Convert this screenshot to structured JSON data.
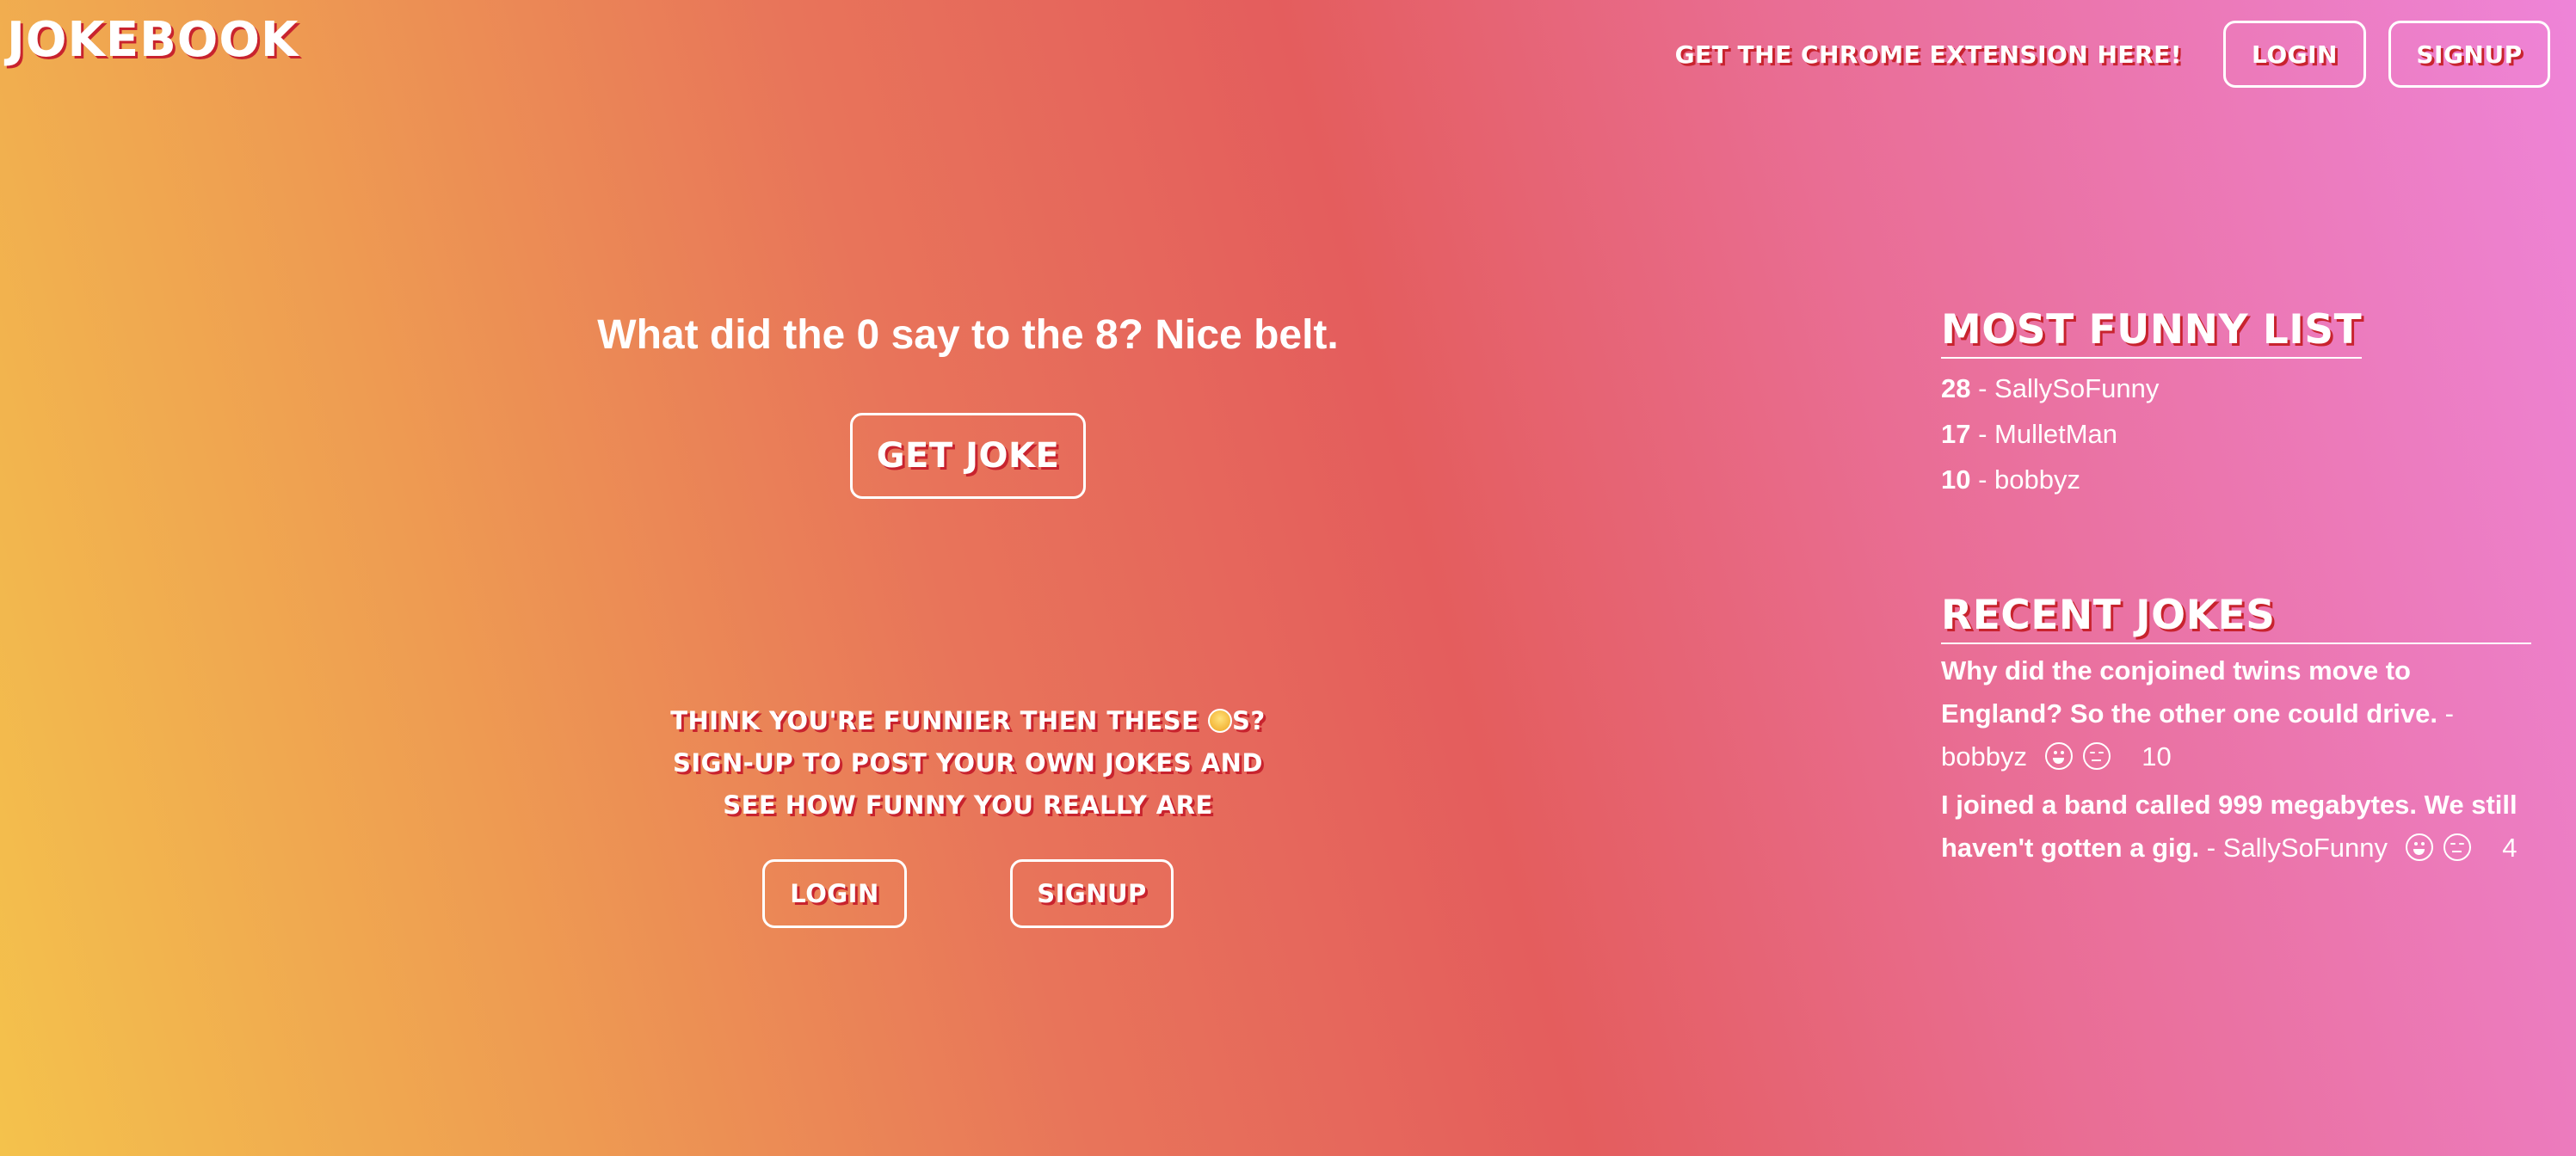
{
  "header": {
    "brand": "JOKEBOOK",
    "extension_link": "GET THE CHROME EXTENSION HERE!",
    "login_label": "LOGIN",
    "signup_label": "SIGNUP"
  },
  "main": {
    "joke": "What did the 0 say to the 8? Nice belt.",
    "get_joke_label": "GET JOKE"
  },
  "promo": {
    "line1_before": "THINK YOU'RE FUNNIER THEN THESE ",
    "line1_after": "S?",
    "line2": "SIGN-UP TO POST YOUR OWN JOKES AND",
    "line3": "SEE HOW FUNNY YOU REALLY ARE",
    "login_label": "LOGIN",
    "signup_label": "SIGNUP",
    "icon": "clown-face-icon"
  },
  "sidebar": {
    "funny_title": "MOST FUNNY LIST",
    "funny_list": [
      {
        "score": "28",
        "sep": " - ",
        "user": "SallySoFunny"
      },
      {
        "score": "17",
        "sep": " - ",
        "user": "MulletMan"
      },
      {
        "score": "10",
        "sep": " - ",
        "user": "bobbyz"
      }
    ],
    "recent_title": "RECENT JOKES",
    "recent_jokes": [
      {
        "text": "Why did the conjoined twins move to England? So the other one could drive.",
        "author": " - bobbyz",
        "votes": "10"
      },
      {
        "text": "I joined a band called 999 megabytes. We still haven't gotten a gig.",
        "author": " - SallySoFunny",
        "votes": "4"
      }
    ]
  },
  "colors": {
    "gradient_start": "#f4c24c",
    "gradient_mid": "#e45d5d",
    "gradient_end": "#ee84d8",
    "display_shadow": "#c8232e"
  }
}
